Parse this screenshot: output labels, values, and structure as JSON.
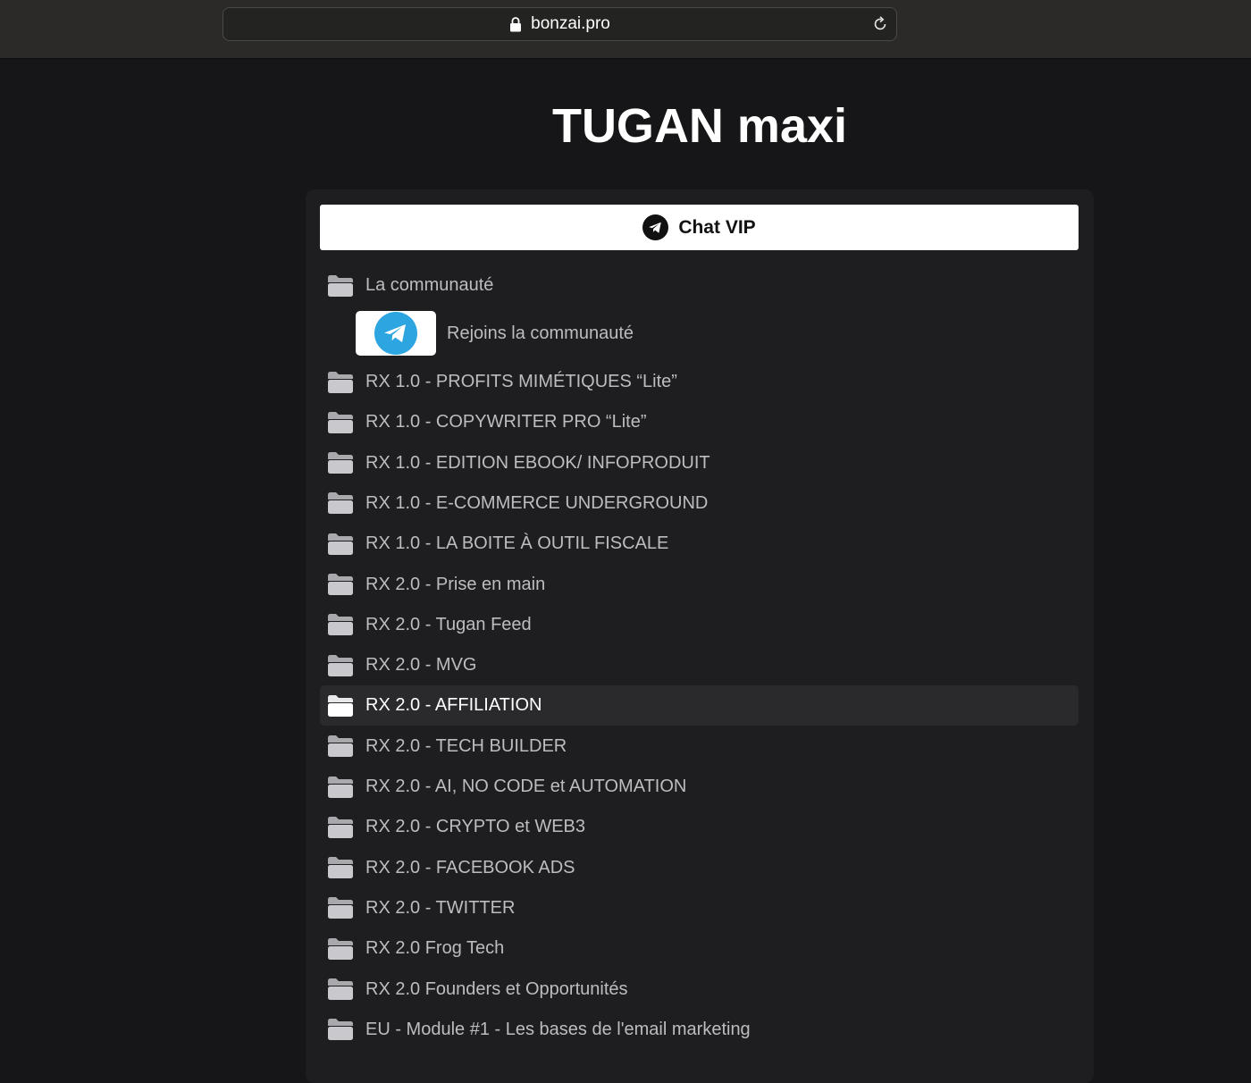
{
  "browser": {
    "url": "bonzai.pro"
  },
  "page": {
    "title": "TUGAN maxi"
  },
  "chat_button": {
    "label": "Chat VIP"
  },
  "community": {
    "label": "La communauté",
    "join_label": "Rejoins la communauté"
  },
  "folders": [
    "RX 1.0 - PROFITS MIMÉTIQUES “Lite”",
    "RX 1.0 - COPYWRITER PRO “Lite”",
    "RX 1.0 - EDITION EBOOK/ INFOPRODUIT",
    "RX 1.0 - E-COMMERCE UNDERGROUND",
    "RX 1.0 - LA BOITE À OUTIL FISCALE",
    "RX 2.0 - Prise en main",
    "RX 2.0 - Tugan Feed",
    "RX 2.0 - MVG",
    "RX 2.0 - AFFILIATION",
    "RX 2.0 - TECH BUILDER",
    "RX 2.0 - AI, NO CODE et AUTOMATION",
    "RX 2.0 - CRYPTO et WEB3",
    "RX 2.0 - FACEBOOK ADS",
    "RX 2.0 - TWITTER",
    "RX 2.0 Frog Tech",
    "RX 2.0 Founders et Opportunités",
    "EU - Module #1 - Les bases de l'email marketing"
  ],
  "active_folder_index": 8,
  "colors": {
    "background": "#161618",
    "panel": "#1e1e20",
    "active_row": "#2a2a2d",
    "telegram_blue": "#2ca5e0"
  },
  "icons": {
    "lock": "lock-icon",
    "reload": "reload-icon",
    "folder": "folder-icon",
    "telegram": "telegram-icon"
  }
}
